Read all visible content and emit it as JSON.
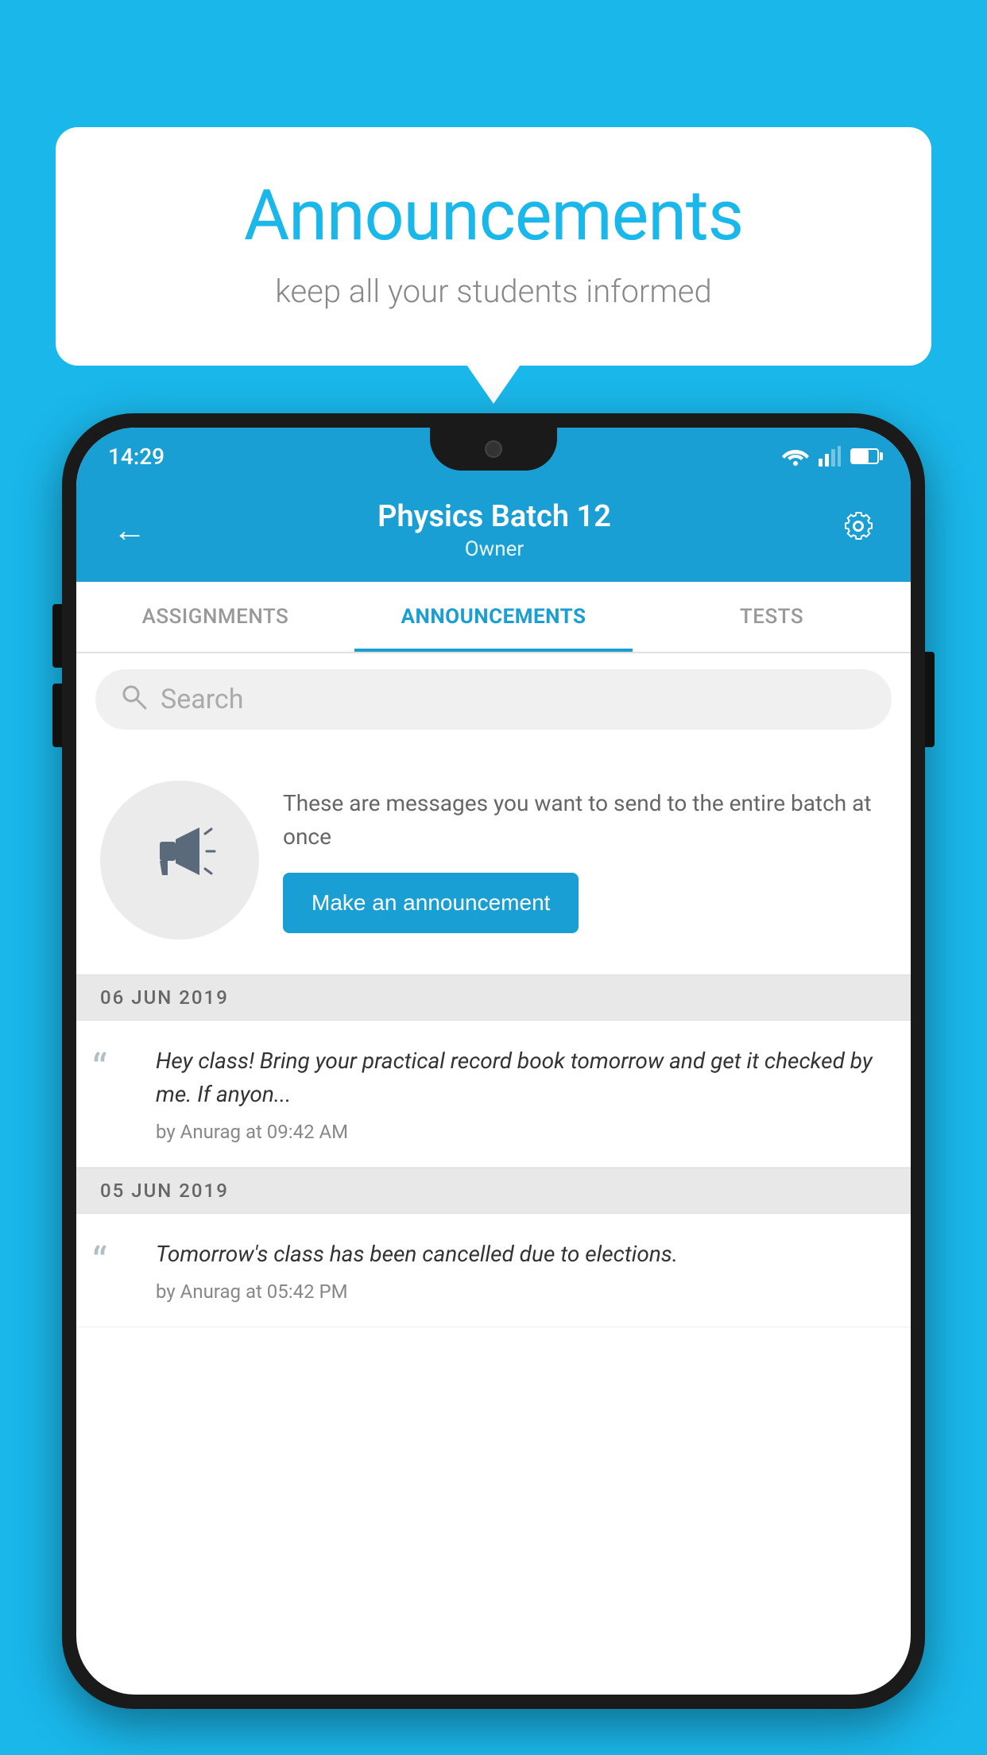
{
  "background_color": "#1ab7ea",
  "bubble": {
    "title": "Announcements",
    "subtitle": "keep all your students informed"
  },
  "phone": {
    "status_bar": {
      "time": "14:29"
    },
    "header": {
      "title": "Physics Batch 12",
      "subtitle": "Owner",
      "back_label": "←"
    },
    "tabs": [
      {
        "label": "ASSIGNMENTS",
        "active": false
      },
      {
        "label": "ANNOUNCEMENTS",
        "active": true
      },
      {
        "label": "TESTS",
        "active": false
      }
    ],
    "search": {
      "placeholder": "Search"
    },
    "announcement_prompt": {
      "description": "These are messages you want to send to the entire batch at once",
      "button_label": "Make an announcement"
    },
    "announcements": [
      {
        "date": "06  JUN  2019",
        "text": "Hey class! Bring your practical record book tomorrow and get it checked by me. If anyon...",
        "meta": "by Anurag at 09:42 AM"
      },
      {
        "date": "05  JUN  2019",
        "text": "Tomorrow's class has been cancelled due to elections.",
        "meta": "by Anurag at 05:42 PM"
      }
    ]
  }
}
